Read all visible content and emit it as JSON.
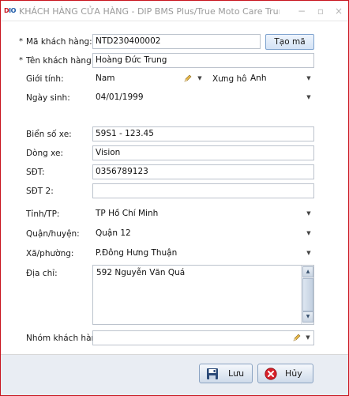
{
  "window": {
    "logo_text": "DIO",
    "title": "KHÁCH HÀNG CỬA HÀNG - DIP BMS Plus/True Moto Care Trun...",
    "minimize_glyph": "−",
    "maximize_glyph": "▫",
    "close_glyph": "×"
  },
  "form": {
    "customer_code": {
      "label": "Mã khách hàng:",
      "required_mark": "*",
      "value": "NTD230400002"
    },
    "generate_code_button": "Tạo mã",
    "customer_name": {
      "label": "Tên khách hàng:",
      "required_mark": "*",
      "value": "Hoàng Đức Trung"
    },
    "gender": {
      "label": "Giới tính:",
      "value": "Nam"
    },
    "salutation": {
      "label": "Xưng hô:",
      "value": "Anh"
    },
    "birthday": {
      "label": "Ngày sinh:",
      "value": "04/01/1999"
    },
    "plate": {
      "label": "Biển số xe:",
      "value": "59S1 - 123.45"
    },
    "bike_model": {
      "label": "Dòng xe:",
      "value": "Vision"
    },
    "phone": {
      "label": "SĐT:",
      "value": "0356789123"
    },
    "phone2": {
      "label": "SĐT 2:",
      "value": ""
    },
    "province": {
      "label": "Tỉnh/TP:",
      "value": "TP Hồ Chí Minh"
    },
    "district": {
      "label": "Quận/huyện:",
      "value": "Quận 12"
    },
    "ward": {
      "label": "Xã/phường:",
      "value": "P.Đông Hưng Thuận"
    },
    "address": {
      "label": "Địa chỉ:",
      "value": "592 Nguyễn Văn Quá"
    },
    "customer_group": {
      "label": "Nhóm khách hàng:",
      "value": ""
    }
  },
  "footer": {
    "save_button": "Lưu",
    "cancel_button": "Hủy"
  },
  "icons": {
    "dropdown": "chevron-down-icon",
    "edit": "pencil-icon",
    "save": "floppy-disk-icon",
    "cancel": "cancel-circle-icon"
  },
  "colors": {
    "window_border": "#c8141e",
    "footer_bg": "#e9edf3",
    "title_text": "#9a9a9a",
    "logo_blue": "#1e5aa8",
    "logo_red": "#c8141e"
  }
}
